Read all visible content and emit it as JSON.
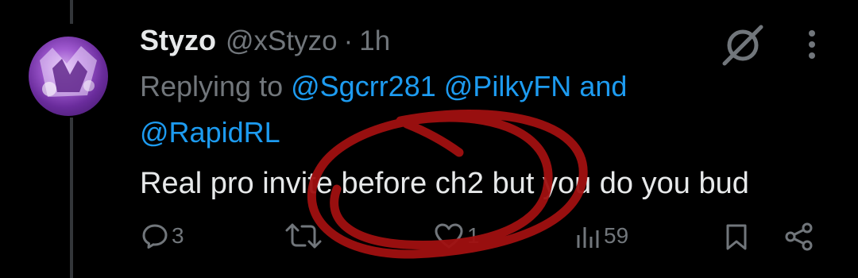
{
  "post": {
    "display_name": "Styzo",
    "handle": "@xStyzo",
    "separator": "·",
    "time": "1h",
    "replying_prefix": "Replying to",
    "mentions": [
      "@Sgcrr281",
      "@PilkyFN"
    ],
    "mention_conjunction": "and",
    "mention_last": "@RapidRL",
    "text": "Real pro invite before ch2 but you do you bud"
  },
  "actions": {
    "replies": "3",
    "reposts": "",
    "likes": "1",
    "views": "59"
  },
  "colors": {
    "background": "#000000",
    "text": "#e7e9ea",
    "secondary": "#71767b",
    "link": "#1d9bf0",
    "annotation_circle": "#a01010"
  },
  "icons": [
    "grok-icon",
    "more-icon",
    "reply-icon",
    "repost-icon",
    "like-icon",
    "views-icon",
    "bookmark-icon",
    "share-icon"
  ]
}
